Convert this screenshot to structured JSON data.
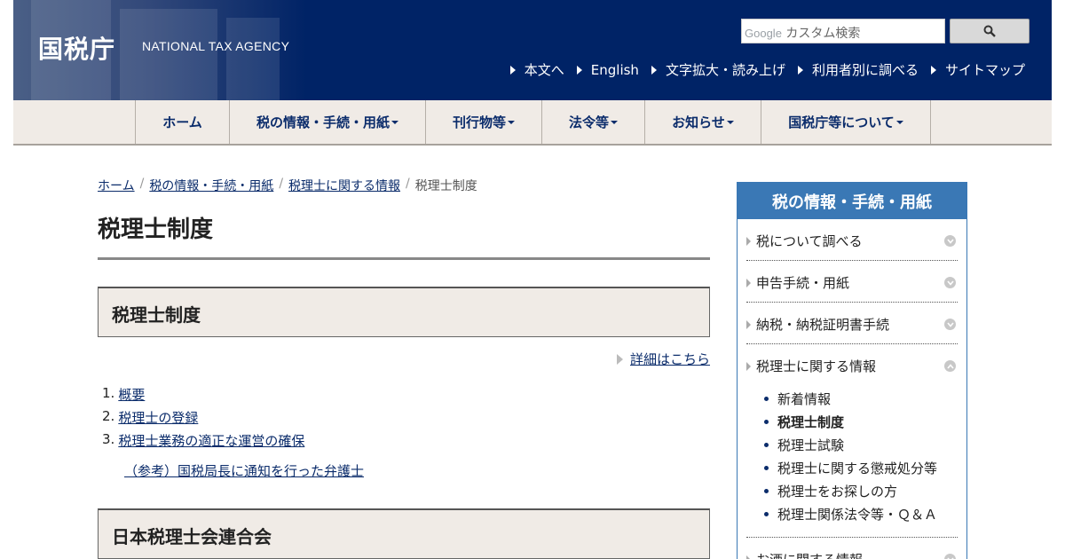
{
  "header": {
    "logo_ja": "国税庁",
    "logo_en": "NATIONAL TAX AGENCY",
    "search": {
      "brand": "Google",
      "placeholder": "カスタム検索"
    },
    "util_links": [
      "本文へ",
      "English",
      "文字拡大・読み上げ",
      "利用者別に調べる",
      "サイトマップ"
    ]
  },
  "gnav": [
    {
      "label": "ホーム",
      "dropdown": false
    },
    {
      "label": "税の情報・手続・用紙",
      "dropdown": true
    },
    {
      "label": "刊行物等",
      "dropdown": true
    },
    {
      "label": "法令等",
      "dropdown": true
    },
    {
      "label": "お知らせ",
      "dropdown": true
    },
    {
      "label": "国税庁等について",
      "dropdown": true
    }
  ],
  "breadcrumb": {
    "items": [
      "ホーム",
      "税の情報・手続・用紙",
      "税理士に関する情報"
    ],
    "current": "税理士制度"
  },
  "main": {
    "title": "税理士制度",
    "section1": {
      "heading": "税理士制度",
      "detail_link": "詳細はこちら",
      "list": [
        "概要",
        "税理士の登録",
        "税理士業務の適正な運営の確保"
      ],
      "ref": "（参考）国税局長に通知を行った弁護士"
    },
    "section2": {
      "heading": "日本税理士会連合会"
    }
  },
  "side": {
    "title": "税の情報・手続・用紙",
    "items": [
      "税について調べる",
      "申告手続・用紙",
      "納税・納税証明書手続",
      "税理士に関する情報",
      "お酒に関する情報"
    ],
    "sub_items": [
      "新着情報",
      "税理士制度",
      "税理士試験",
      "税理士に関する懲戒処分等",
      "税理士をお探しの方",
      "税理士関係法令等・Ｑ＆Ａ"
    ],
    "current_sub": "税理士制度"
  },
  "colors": {
    "header_bg": "#002366",
    "nav_bg": "#f0ebe6",
    "side_accent": "#3a78b5",
    "link": "#0b2c6b"
  }
}
